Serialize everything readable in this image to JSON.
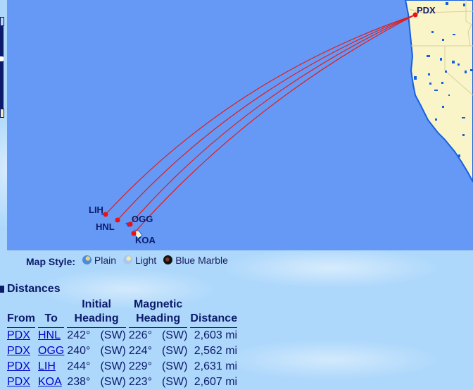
{
  "map": {
    "airports": [
      {
        "code": "PDX",
        "role": "origin"
      },
      {
        "code": "LIH",
        "role": "destination"
      },
      {
        "code": "HNL",
        "role": "destination"
      },
      {
        "code": "OGG",
        "role": "destination"
      },
      {
        "code": "KOA",
        "role": "destination"
      }
    ],
    "colors": {
      "ocean": "#6699f5",
      "land": "#faf5c8",
      "route": "#e01c1c",
      "label": "#0b1a6b"
    }
  },
  "map_style": {
    "label": "Map Style:",
    "options": [
      {
        "label": "Plain",
        "icon": "globe-plain-icon"
      },
      {
        "label": "Light",
        "icon": "globe-light-icon"
      },
      {
        "label": "Blue Marble",
        "icon": "globe-blue-marble-icon"
      }
    ]
  },
  "distances": {
    "title": "Distances",
    "headers": {
      "from": "From",
      "to": "To",
      "initial_heading_line1": "Initial",
      "initial_heading_line2": "Heading",
      "magnetic_heading_line1": "Magnetic",
      "magnetic_heading_line2": "Heading",
      "distance": "Distance"
    },
    "rows": [
      {
        "from": "PDX",
        "to": "HNL",
        "initial": "242°",
        "initial_dir": "(SW)",
        "magnetic": "226°",
        "magnetic_dir": "(SW)",
        "distance": "2,603 mi"
      },
      {
        "from": "PDX",
        "to": "OGG",
        "initial": "240°",
        "initial_dir": "(SW)",
        "magnetic": "224°",
        "magnetic_dir": "(SW)",
        "distance": "2,562 mi"
      },
      {
        "from": "PDX",
        "to": "LIH",
        "initial": "244°",
        "initial_dir": "(SW)",
        "magnetic": "229°",
        "magnetic_dir": "(SW)",
        "distance": "2,631 mi"
      },
      {
        "from": "PDX",
        "to": "KOA",
        "initial": "238°",
        "initial_dir": "(SW)",
        "magnetic": "223°",
        "magnetic_dir": "(SW)",
        "distance": "2,607 mi"
      }
    ]
  }
}
